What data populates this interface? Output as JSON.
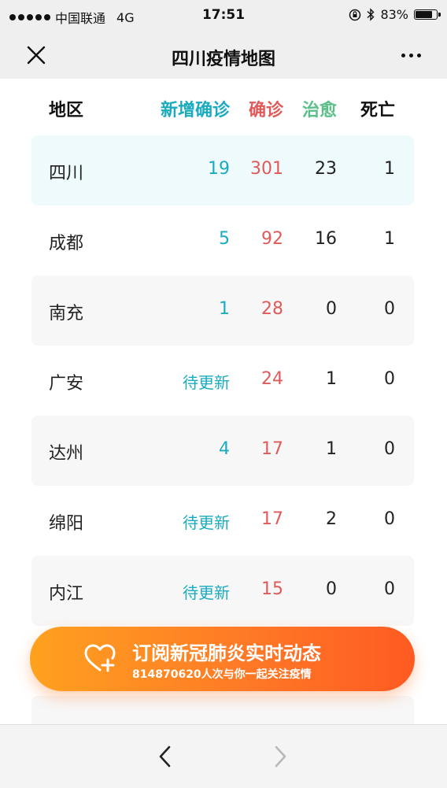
{
  "status_bar": {
    "carrier": "中国联通",
    "network": "4G",
    "time": "17:51",
    "battery_percent": "83%",
    "battery_level": 0.83
  },
  "nav": {
    "title": "四川疫情地图",
    "close_icon": "close-icon",
    "more_icon": "more-icon"
  },
  "table": {
    "headers": {
      "region": "地区",
      "new": "新增确诊",
      "confirmed": "确诊",
      "cured": "治愈",
      "deaths": "死亡"
    },
    "header_colors": {
      "region": "#111111",
      "new": "#1aabbf",
      "confirmed": "#e05a5a",
      "cured": "#5cbf8a",
      "deaths": "#111111"
    },
    "rows": [
      {
        "region": "四川",
        "new": "19",
        "confirmed": "301",
        "cured": "23",
        "deaths": "1"
      },
      {
        "region": "成都",
        "new": "5",
        "confirmed": "92",
        "cured": "16",
        "deaths": "1"
      },
      {
        "region": "南充",
        "new": "1",
        "confirmed": "28",
        "cured": "0",
        "deaths": "0"
      },
      {
        "region": "广安",
        "new": "待更新",
        "confirmed": "24",
        "cured": "1",
        "deaths": "0"
      },
      {
        "region": "达州",
        "new": "4",
        "confirmed": "17",
        "cured": "1",
        "deaths": "0"
      },
      {
        "region": "绵阳",
        "new": "待更新",
        "confirmed": "17",
        "cured": "2",
        "deaths": "0"
      },
      {
        "region": "内江",
        "new": "待更新",
        "confirmed": "15",
        "cured": "0",
        "deaths": "0"
      }
    ]
  },
  "cta": {
    "title": "订阅新冠肺炎实时动态",
    "subtitle": "814870620人次与你一起关注疫情",
    "icon": "heart-plus-icon"
  },
  "bottom_nav": {
    "back_icon": "chevron-left-icon",
    "forward_icon": "chevron-right-icon"
  }
}
